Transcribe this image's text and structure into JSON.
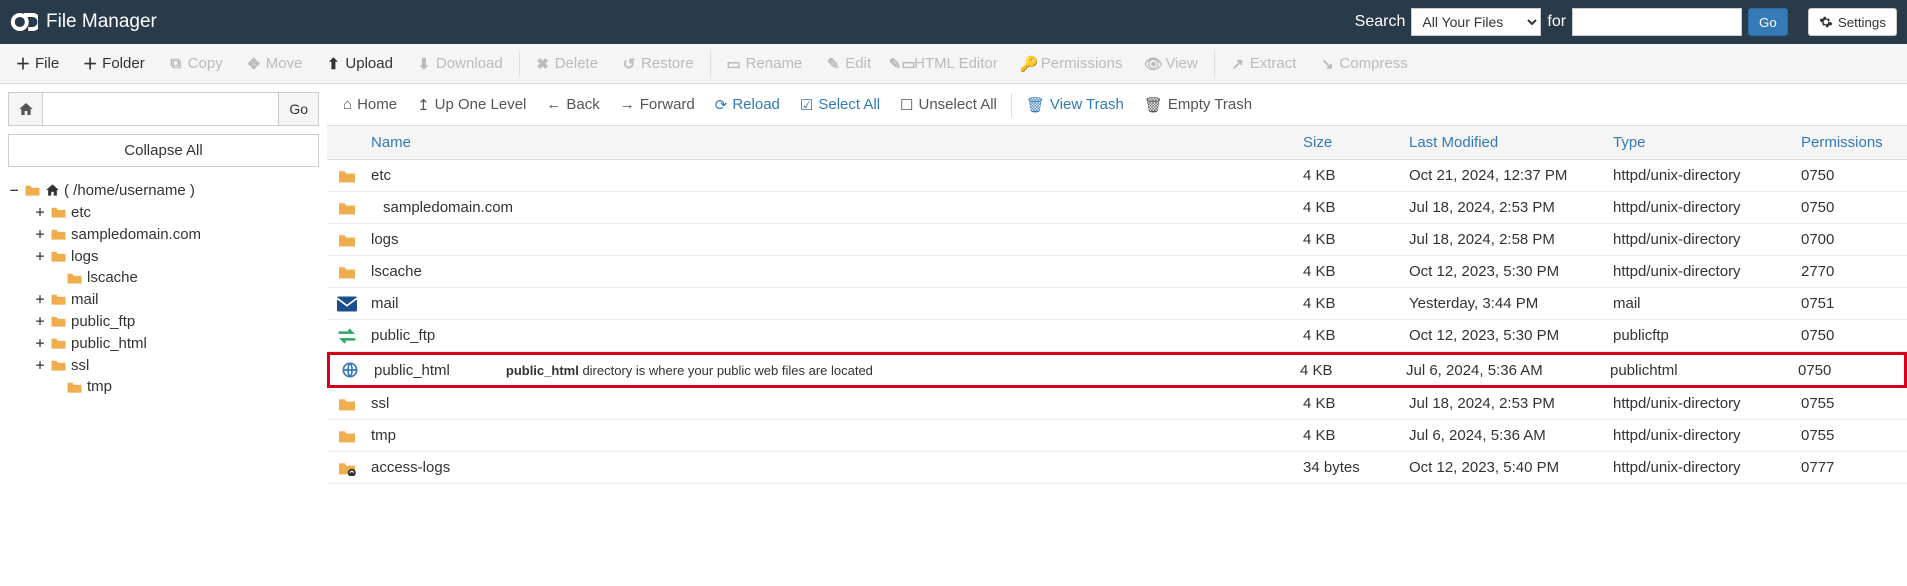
{
  "header": {
    "title": "File Manager",
    "search_label": "Search",
    "search_scope": "All Your Files",
    "for_label": "for",
    "search_term": "",
    "go": "Go",
    "settings": "Settings"
  },
  "toolbar": [
    {
      "id": "file",
      "label": "File",
      "icon": "plus",
      "enabled": true
    },
    {
      "id": "folder",
      "label": "Folder",
      "icon": "plus",
      "enabled": true
    },
    {
      "id": "copy",
      "label": "Copy",
      "icon": "copy",
      "enabled": false
    },
    {
      "id": "move",
      "label": "Move",
      "icon": "move",
      "enabled": false
    },
    {
      "id": "upload",
      "label": "Upload",
      "icon": "upload",
      "enabled": true
    },
    {
      "id": "download",
      "label": "Download",
      "icon": "download",
      "enabled": false
    },
    {
      "id": "sep1",
      "sep": true
    },
    {
      "id": "delete",
      "label": "Delete",
      "icon": "delete",
      "enabled": false
    },
    {
      "id": "restore",
      "label": "Restore",
      "icon": "restore",
      "enabled": false
    },
    {
      "id": "sep2",
      "sep": true
    },
    {
      "id": "rename",
      "label": "Rename",
      "icon": "rename",
      "enabled": false
    },
    {
      "id": "edit",
      "label": "Edit",
      "icon": "edit",
      "enabled": false
    },
    {
      "id": "htmleditor",
      "label": "HTML Editor",
      "icon": "html",
      "enabled": false
    },
    {
      "id": "permissions",
      "label": "Permissions",
      "icon": "perm",
      "enabled": false
    },
    {
      "id": "view",
      "label": "View",
      "icon": "view",
      "enabled": false
    },
    {
      "id": "sep3",
      "sep": true
    },
    {
      "id": "extract",
      "label": "Extract",
      "icon": "extract",
      "enabled": false
    },
    {
      "id": "compress",
      "label": "Compress",
      "icon": "compress",
      "enabled": false
    }
  ],
  "pathbar": {
    "value": "",
    "go": "Go"
  },
  "collapse_all": "Collapse All",
  "tree": {
    "root_label": "( /home/username )",
    "nodes": [
      {
        "label": "etc",
        "exp": "+",
        "depth": 1,
        "open": false
      },
      {
        "label": "sampledomain.com",
        "exp": "+",
        "depth": 1,
        "open": false
      },
      {
        "label": "logs",
        "exp": "+",
        "depth": 1,
        "open": false
      },
      {
        "label": "lscache",
        "exp": "",
        "depth": 2,
        "open": false
      },
      {
        "label": "mail",
        "exp": "+",
        "depth": 1,
        "open": false
      },
      {
        "label": "public_ftp",
        "exp": "+",
        "depth": 1,
        "open": false
      },
      {
        "label": "public_html",
        "exp": "+",
        "depth": 1,
        "open": false
      },
      {
        "label": "ssl",
        "exp": "+",
        "depth": 1,
        "open": false
      },
      {
        "label": "tmp",
        "exp": "",
        "depth": 2,
        "open": false
      }
    ]
  },
  "navbar": [
    {
      "id": "home",
      "label": "Home",
      "icon": "home",
      "color": ""
    },
    {
      "id": "up",
      "label": "Up One Level",
      "icon": "up",
      "color": ""
    },
    {
      "id": "back",
      "label": "Back",
      "icon": "left",
      "color": ""
    },
    {
      "id": "forward",
      "label": "Forward",
      "icon": "right",
      "color": ""
    },
    {
      "id": "reload",
      "label": "Reload",
      "icon": "reload",
      "color": "blue"
    },
    {
      "id": "selectall",
      "label": "Select All",
      "icon": "check",
      "color": "blue"
    },
    {
      "id": "unselect",
      "label": "Unselect All",
      "icon": "uncheck",
      "color": ""
    },
    {
      "id": "sep",
      "sep": true
    },
    {
      "id": "viewtrash",
      "label": "View Trash",
      "icon": "trash",
      "color": "blue"
    },
    {
      "id": "emptytrash",
      "label": "Empty Trash",
      "icon": "trash",
      "color": ""
    }
  ],
  "columns": {
    "name": "Name",
    "size": "Size",
    "modified": "Last Modified",
    "type": "Type",
    "perm": "Permissions"
  },
  "rows": [
    {
      "icon": "folder",
      "name": "etc",
      "size": "4 KB",
      "mod": "Oct 21, 2024, 12:37 PM",
      "type": "httpd/unix-directory",
      "perm": "0750"
    },
    {
      "icon": "folder",
      "name": "sampledomain.com",
      "size": "4 KB",
      "mod": "Jul 18, 2024, 2:53 PM",
      "type": "httpd/unix-directory",
      "perm": "0750",
      "indent": true
    },
    {
      "icon": "folder",
      "name": "logs",
      "size": "4 KB",
      "mod": "Jul 18, 2024, 2:58 PM",
      "type": "httpd/unix-directory",
      "perm": "0700"
    },
    {
      "icon": "folder",
      "name": "lscache",
      "size": "4 KB",
      "mod": "Oct 12, 2023, 5:30 PM",
      "type": "httpd/unix-directory",
      "perm": "2770"
    },
    {
      "icon": "mail",
      "name": "mail",
      "size": "4 KB",
      "mod": "Yesterday, 3:44 PM",
      "type": "mail",
      "perm": "0751"
    },
    {
      "icon": "ftp",
      "name": "public_ftp",
      "size": "4 KB",
      "mod": "Oct 12, 2023, 5:30 PM",
      "type": "publicftp",
      "perm": "0750"
    },
    {
      "icon": "globe",
      "name": "public_html",
      "size": "4 KB",
      "mod": "Jul 6, 2024, 5:36 AM",
      "type": "publichtml",
      "perm": "0750",
      "highlight": true,
      "note_bold": "public_html",
      "note_rest": " directory is where your public web files are located"
    },
    {
      "icon": "folder",
      "name": "ssl",
      "size": "4 KB",
      "mod": "Jul 18, 2024, 2:53 PM",
      "type": "httpd/unix-directory",
      "perm": "0755"
    },
    {
      "icon": "folder",
      "name": "tmp",
      "size": "4 KB",
      "mod": "Jul 6, 2024, 5:36 AM",
      "type": "httpd/unix-directory",
      "perm": "0755"
    },
    {
      "icon": "link",
      "name": "access-logs",
      "size": "34 bytes",
      "mod": "Oct 12, 2023, 5:40 PM",
      "type": "httpd/unix-directory",
      "perm": "0777"
    }
  ]
}
